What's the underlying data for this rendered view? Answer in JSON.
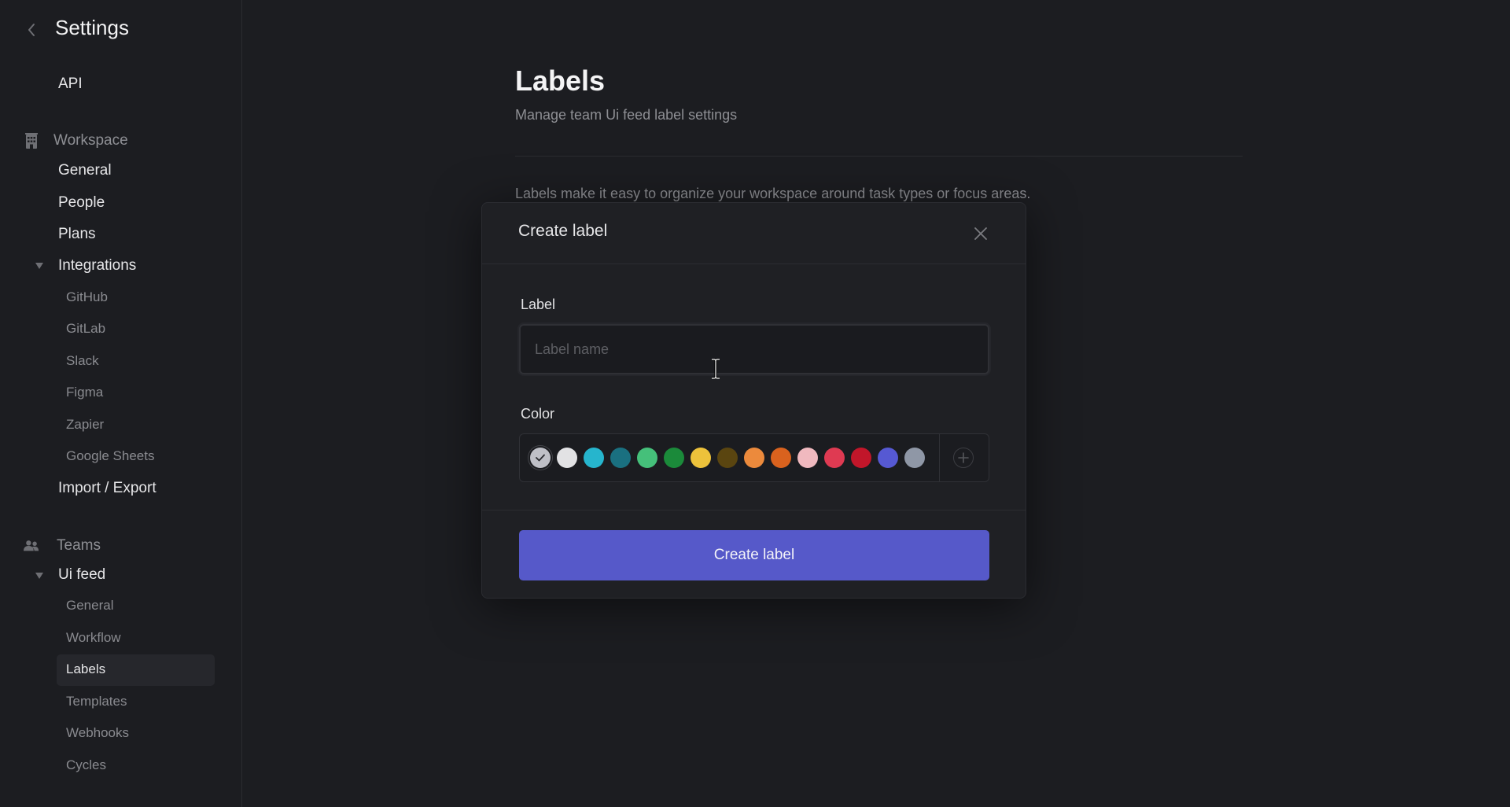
{
  "sidebar": {
    "title": "Settings",
    "back_icon": "chevron-left-icon",
    "top_items": [
      {
        "label": "API"
      }
    ],
    "workspace": {
      "label": "Workspace",
      "icon": "building-icon",
      "items": [
        {
          "label": "General"
        },
        {
          "label": "People"
        },
        {
          "label": "Plans"
        }
      ],
      "integrations": {
        "label": "Integrations",
        "expanded": true,
        "items": [
          {
            "label": "GitHub"
          },
          {
            "label": "GitLab"
          },
          {
            "label": "Slack"
          },
          {
            "label": "Figma"
          },
          {
            "label": "Zapier"
          },
          {
            "label": "Google Sheets"
          }
        ]
      },
      "after_items": [
        {
          "label": "Import / Export"
        }
      ]
    },
    "teams": {
      "label": "Teams",
      "icon": "users-icon",
      "team": {
        "label": "Ui feed",
        "expanded": true,
        "items": [
          {
            "label": "General"
          },
          {
            "label": "Workflow"
          },
          {
            "label": "Labels",
            "active": true
          },
          {
            "label": "Templates"
          },
          {
            "label": "Webhooks"
          },
          {
            "label": "Cycles"
          }
        ]
      }
    }
  },
  "main": {
    "title": "Labels",
    "subtitle": "Manage team Ui feed label settings",
    "description": "Labels make it easy to organize your workspace around task types or focus areas."
  },
  "modal": {
    "title": "Create label",
    "label_field": {
      "label": "Label",
      "placeholder": "Label name",
      "value": ""
    },
    "color_field": {
      "label": "Color",
      "selected_index": 0,
      "colors": [
        "#bfc0c7",
        "#e2e2e4",
        "#26b5cd",
        "#1a7080",
        "#45c07a",
        "#1b8a3a",
        "#edc23b",
        "#5a4510",
        "#ec8a3c",
        "#d9621e",
        "#f0b9bf",
        "#df3a52",
        "#c2162a",
        "#5659d3",
        "#8f97a6"
      ]
    },
    "submit_label": "Create label",
    "accent_color": "#5659c9"
  }
}
